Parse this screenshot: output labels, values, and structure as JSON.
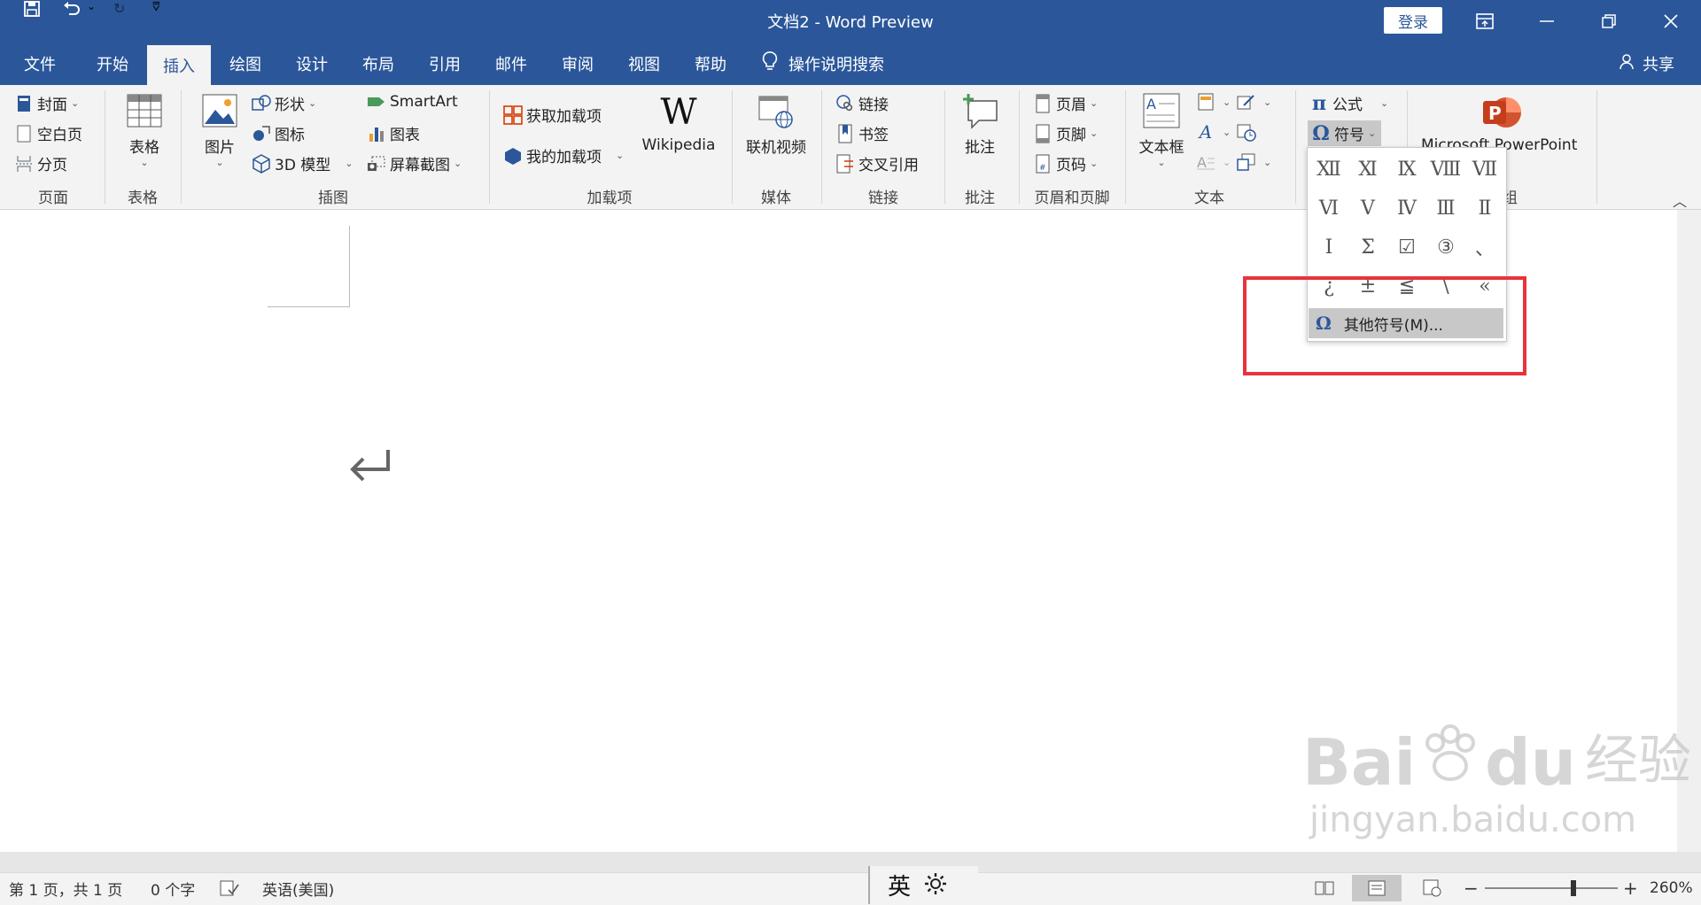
{
  "titlebar": {
    "title": "文档2  -  Word Preview",
    "login_label": "登录",
    "icons": [
      "save-icon",
      "undo-icon",
      "redo-icon",
      "customize-icon",
      "ribbon-display-icon",
      "minimize-icon",
      "restore-icon",
      "close-icon"
    ]
  },
  "tabs": [
    {
      "label": "文件"
    },
    {
      "label": "开始"
    },
    {
      "label": "插入"
    },
    {
      "label": "绘图"
    },
    {
      "label": "设计"
    },
    {
      "label": "布局"
    },
    {
      "label": "引用"
    },
    {
      "label": "邮件"
    },
    {
      "label": "审阅"
    },
    {
      "label": "视图"
    },
    {
      "label": "帮助"
    }
  ],
  "active_tab": "插入",
  "search_label": "操作说明搜索",
  "share_label": "共享",
  "ribbon": {
    "page": {
      "label": "页面",
      "cover": "封面",
      "blank": "空白页",
      "break": "分页"
    },
    "table": {
      "label": "表格",
      "table": "表格"
    },
    "illustrations": {
      "label": "插图",
      "picture": "图片",
      "shapes": "形状",
      "icons": "图标",
      "model3d": "3D 模型",
      "smartart": "SmartArt",
      "chart": "图表",
      "screenshot": "屏幕截图"
    },
    "addins": {
      "label": "加载项",
      "get": "获取加载项",
      "my": "我的加载项",
      "wikipedia": "Wikipedia"
    },
    "media": {
      "label": "媒体",
      "video": "联机视频"
    },
    "links": {
      "label": "链接",
      "link": "链接",
      "bookmark": "书签",
      "crossref": "交叉引用"
    },
    "comments": {
      "label": "批注",
      "comment": "批注"
    },
    "headerfooter": {
      "label": "页眉和页脚",
      "header": "页眉",
      "footer": "页脚",
      "pagenum": "页码"
    },
    "text": {
      "label": "文本",
      "textbox": "文本框"
    },
    "symbols": {
      "equation": "公式",
      "symbol": "符号"
    },
    "powerpoint": {
      "label": "Microsoft PowerPoint",
      "group_suffix": "组"
    }
  },
  "symbol_menu": {
    "rows": [
      [
        "Ⅻ",
        "Ⅺ",
        "Ⅸ",
        "Ⅷ",
        "Ⅶ"
      ],
      [
        "Ⅵ",
        "Ⅴ",
        "Ⅳ",
        "Ⅲ",
        "Ⅱ"
      ],
      [
        "Ⅰ",
        "Σ",
        "☑",
        "③",
        "、"
      ],
      [
        "¿",
        "±",
        "≦",
        "\\",
        "«"
      ]
    ],
    "more_label": "其他符号(M)..."
  },
  "statusbar": {
    "page": "第 1 页，共 1 页",
    "words": "0 个字",
    "language": "英语(美国)",
    "ime": "英",
    "zoom": "260%"
  },
  "watermark": {
    "brand": "Bai",
    "brand2": "du",
    "suffix": "经验",
    "url": "jingyan.baidu.com"
  },
  "colors": {
    "accent": "#2b579a",
    "highlight": "#e8333a"
  }
}
